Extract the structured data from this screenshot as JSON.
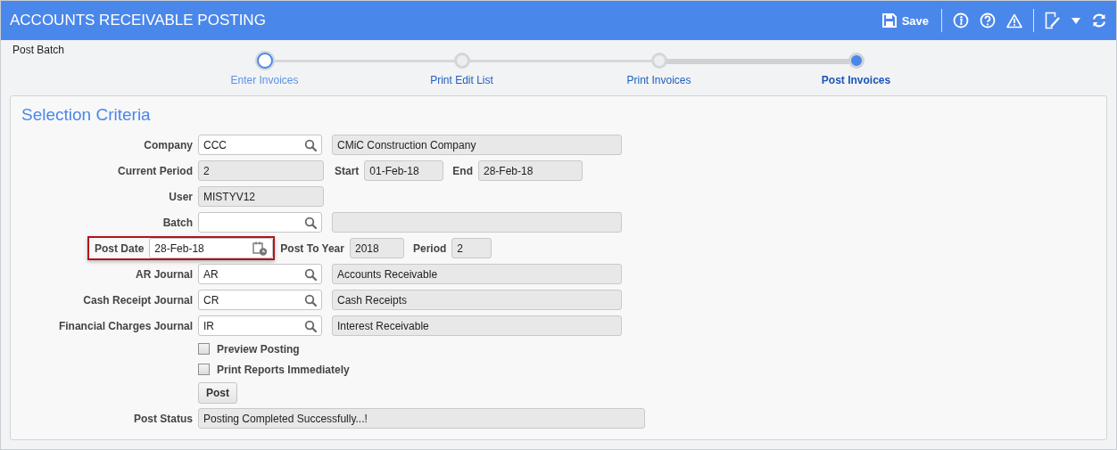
{
  "header": {
    "title": "ACCOUNTS RECEIVABLE POSTING",
    "save_label": "Save"
  },
  "breadcrumb": "Post Batch",
  "steps": [
    {
      "label": "Enter Invoices",
      "visited": true,
      "selected": false
    },
    {
      "label": "Print Edit List",
      "visited": false,
      "selected": false
    },
    {
      "label": "Print Invoices",
      "visited": false,
      "selected": false
    },
    {
      "label": "Post Invoices",
      "visited": false,
      "selected": true
    }
  ],
  "section_title": "Selection Criteria",
  "rows": [
    {
      "kind": "lookup",
      "label": "Company",
      "value": "CCC",
      "description": "CMiC Construction Company"
    },
    {
      "kind": "readonly",
      "label": "Current Period",
      "value": "2",
      "extras": [
        {
          "label": "Start",
          "value": "01-Feb-18"
        },
        {
          "label": "End",
          "value": "28-Feb-18"
        }
      ]
    },
    {
      "kind": "readonly",
      "label": "User",
      "value": "MISTYV12"
    },
    {
      "kind": "lookup",
      "label": "Batch",
      "description": ""
    },
    {
      "kind": "date",
      "label": "Post Date",
      "value": "28-Feb-18",
      "highlighted": true,
      "extras": [
        {
          "label": "Post To Year",
          "value": "2018"
        },
        {
          "label": "Period",
          "value": "2"
        }
      ]
    },
    {
      "kind": "lookup",
      "label": "AR Journal",
      "value": "AR",
      "description": "Accounts Receivable"
    },
    {
      "kind": "lookup",
      "label": "Cash Receipt Journal",
      "value": "CR",
      "description": "Cash Receipts"
    },
    {
      "kind": "lookup",
      "label": "Financial Charges Journal",
      "value": "IR",
      "description": "Interest Receivable"
    },
    {
      "kind": "checkbox",
      "label": "Preview Posting",
      "checked": false
    },
    {
      "kind": "checkbox",
      "label": "Print Reports Immediately",
      "checked": false
    },
    {
      "kind": "button",
      "label": "Post"
    },
    {
      "kind": "status",
      "label": "Post Status",
      "value": "Posting Completed Successfully...!"
    }
  ]
}
